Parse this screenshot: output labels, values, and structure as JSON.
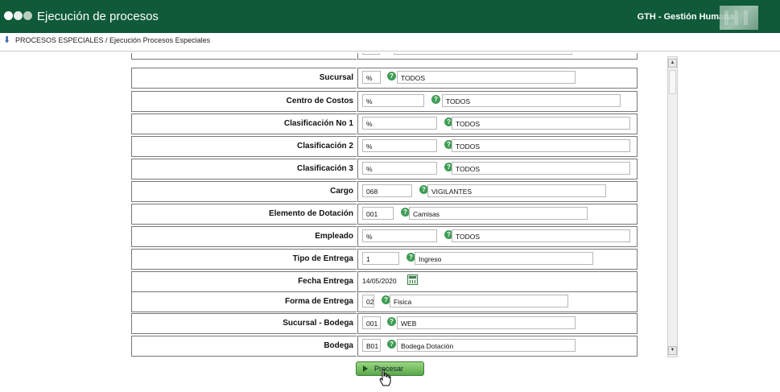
{
  "header": {
    "title": "Ejecución de procesos",
    "brand": "GTH - Gestión Humana"
  },
  "breadcrumb": {
    "text": "PROCESOS ESPECIALES / Ejecución Procesos Especiales"
  },
  "form": {
    "rows": [
      {
        "label": "Sucursal",
        "code": "%",
        "desc": "TODOS"
      },
      {
        "label": "Centro de Costos",
        "code": "%",
        "desc": "TODOS"
      },
      {
        "label": "Clasificación No 1",
        "code": "%",
        "desc": "TODOS"
      },
      {
        "label": "Clasificación 2",
        "code": "%",
        "desc": "TODOS"
      },
      {
        "label": "Clasificación 3",
        "code": "%",
        "desc": "TODOS"
      },
      {
        "label": "Cargo",
        "code": "068",
        "desc": "VIGILANTES"
      },
      {
        "label": "Elemento de Dotación",
        "code": "001",
        "desc": "Camisas"
      },
      {
        "label": "Empleado",
        "code": "%",
        "desc": "TODOS"
      },
      {
        "label": "Tipo de Entrega",
        "code": "1",
        "desc": "Ingreso"
      },
      {
        "label": "Fecha Entrega",
        "date": "14/05/2020"
      },
      {
        "label": "Forma de Entrega",
        "code": "02",
        "desc": "Fisica"
      },
      {
        "label": "Sucursal - Bodega",
        "code": "001",
        "desc": "WEB"
      },
      {
        "label": "Bodega",
        "code": "B01",
        "desc": "Bodega Dotación"
      }
    ]
  },
  "actions": {
    "process_label": "Procesar"
  },
  "icons": {
    "help": "help-icon",
    "calendar": "calendar-icon",
    "breadcrumb": "down-arrow-icon",
    "process": "play-icon"
  },
  "colors": {
    "header_bg": "#0f5a38",
    "button_green": "#5aa84a"
  }
}
